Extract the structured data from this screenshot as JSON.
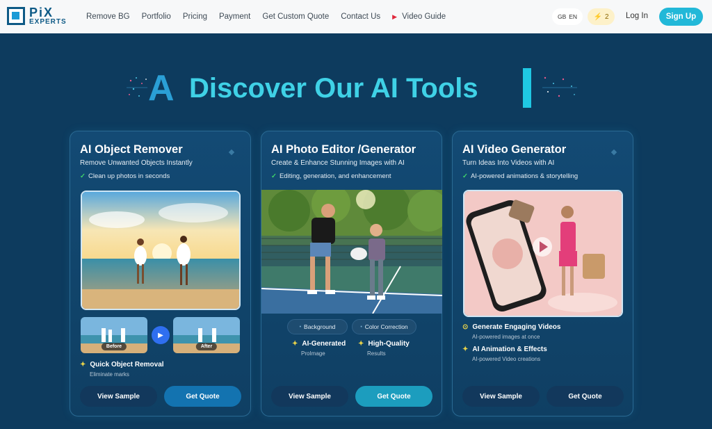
{
  "header": {
    "logo_top": "PiX",
    "logo_bottom": "EXPERTS",
    "nav": [
      "Remove BG",
      "Portfolio",
      "Pricing",
      "Payment",
      "Get Custom Quote",
      "Contact Us",
      "Video Guide"
    ],
    "lang_flag": "GB",
    "lang": "EN",
    "credits": "2",
    "login": "Log In",
    "signup": "Sign Up"
  },
  "hero": {
    "letter": "A",
    "title": "Discover Our AI Tools"
  },
  "cards": [
    {
      "title": "AI Object Remover",
      "subtitle": "Remove Unwanted Objects Instantly",
      "check": "Clean up photos in seconds",
      "before": "Before",
      "after": "After",
      "feature": "Quick Object Removal",
      "feature_sub": "Eliminate marks",
      "btn_sample": "View Sample",
      "btn_quote": "Get Quote"
    },
    {
      "title": "AI Photo Editor /Generator",
      "subtitle": "Create & Enhance Stunning Images with AI",
      "check": "Editing, generation, and enhancement",
      "chips": [
        "Background",
        "Color Correction"
      ],
      "f1": "AI-Generated",
      "f1_sub": "ProImage",
      "f2": "High-Quality",
      "f2_sub": "Results",
      "btn_sample": "View Sample",
      "btn_quote": "Get Quote"
    },
    {
      "title": "AI Video Generator",
      "subtitle": "Turn Ideas Into Videos with AI",
      "check": "AI-powered animations & storytelling",
      "f1": "Generate Engaging Videos",
      "f1_sub": "AI-powered images at once",
      "f2": "AI Animation & Effects",
      "f2_sub": "AI-powered Video creations",
      "btn_sample": "View Sample",
      "btn_quote": "Get Quote"
    }
  ],
  "colors": {
    "background": "#0d3b5e",
    "accent_cyan": "#3fd1e6",
    "signup": "#22b8d8",
    "check": "#3fd66a"
  }
}
